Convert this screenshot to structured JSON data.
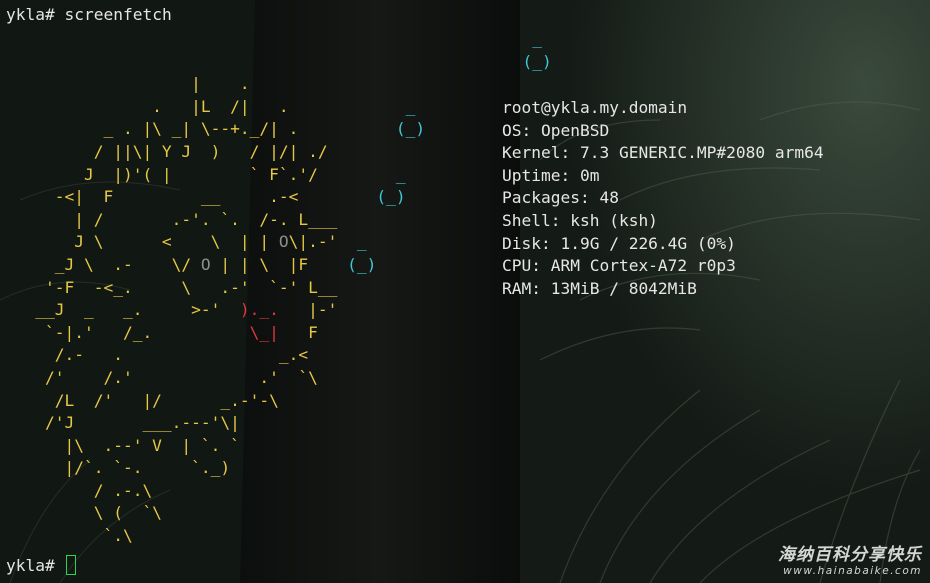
{
  "terminal": {
    "prompt": "ykla#",
    "command": "screenfetch",
    "colors": {
      "background": "#101612",
      "text": "#e6e6e6",
      "logo_yellow": "#e7c845",
      "logo_cyan": "#3fc7d6",
      "logo_red": "#e0393c",
      "logo_gray": "#8a8f8f",
      "cursor_green": "#2fd257"
    }
  },
  "logo_lines": [
    [
      {
        "t": "                                                      ",
        "k": "y"
      },
      {
        "t": "_",
        "k": "c"
      }
    ],
    [
      {
        "t": "                                                     ",
        "k": "y"
      },
      {
        "t": "(_)",
        "k": "c"
      }
    ],
    [
      {
        "t": "                   |    .",
        "k": "y"
      }
    ],
    [
      {
        "t": "               .   |L  /|   .            ",
        "k": "y"
      },
      {
        "t": "_",
        "k": "c"
      }
    ],
    [
      {
        "t": "          _ . |\\ _| \\--+._/| .          ",
        "k": "y"
      },
      {
        "t": "(_)",
        "k": "c"
      }
    ],
    [
      {
        "t": "         / ||\\| Y J  )   / |/| ./",
        "k": "y"
      }
    ],
    [
      {
        "t": "        J  |)'( |        ` F`.'/        ",
        "k": "y"
      },
      {
        "t": "_",
        "k": "c"
      }
    ],
    [
      {
        "t": "     -<|  F         __     .-<        ",
        "k": "y"
      },
      {
        "t": "(_)",
        "k": "c"
      }
    ],
    [
      {
        "t": "       | /       .-'. `.  /-. L___",
        "k": "y"
      }
    ],
    [
      {
        "t": "       J \\      <    \\  | | ",
        "k": "y"
      },
      {
        "t": "O",
        "k": "g"
      },
      {
        "t": "\\|.-'  ",
        "k": "y"
      },
      {
        "t": "_",
        "k": "c"
      }
    ],
    [
      {
        "t": "     _J \\  .-    \\/ ",
        "k": "y"
      },
      {
        "t": "O",
        "k": "g"
      },
      {
        "t": " | | \\  |F    ",
        "k": "y"
      },
      {
        "t": "(_)",
        "k": "c"
      }
    ],
    [
      {
        "t": "    '-F  -<_.     \\   .-'  `-' L__",
        "k": "y"
      }
    ],
    [
      {
        "t": "   __J  _   _.     >-'  ",
        "k": "y"
      },
      {
        "t": ")._.",
        "k": "r"
      },
      {
        "t": "   |-'",
        "k": "y"
      }
    ],
    [
      {
        "t": "    `-|.'   /_.          ",
        "k": "y"
      },
      {
        "t": "\\_|",
        "k": "r"
      },
      {
        "t": "   F",
        "k": "y"
      }
    ],
    [
      {
        "t": "     /.-   .                _.<",
        "k": "y"
      }
    ],
    [
      {
        "t": "    /'    /.'             .'  `\\",
        "k": "y"
      }
    ],
    [
      {
        "t": "     /L  /'   |/      _.-'-\\",
        "k": "y"
      }
    ],
    [
      {
        "t": "    /'J       ___.---'\\|",
        "k": "y"
      }
    ],
    [
      {
        "t": "      |\\  .--' V  | `. `",
        "k": "y"
      }
    ],
    [
      {
        "t": "      |/`. `-.     `._)",
        "k": "y"
      }
    ],
    [
      {
        "t": "         / .-.\\",
        "k": "y"
      }
    ],
    [
      {
        "t": "         \\ (  `\\",
        "k": "y"
      }
    ],
    [
      {
        "t": "          `.\\",
        "k": "y"
      }
    ]
  ],
  "system_info": [
    "root@ykla.my.domain",
    "OS: OpenBSD",
    "Kernel: 7.3 GENERIC.MP#2080 arm64",
    "Uptime: 0m",
    "Packages: 48",
    "Shell: ksh (ksh)",
    "Disk: 1.9G / 226.4G (0%)",
    "CPU: ARM Cortex-A72 r0p3",
    "RAM: 13MiB / 8042MiB"
  ],
  "watermark": {
    "chinese": "海纳百科分享快乐",
    "url": "www.hainabaike.com"
  }
}
